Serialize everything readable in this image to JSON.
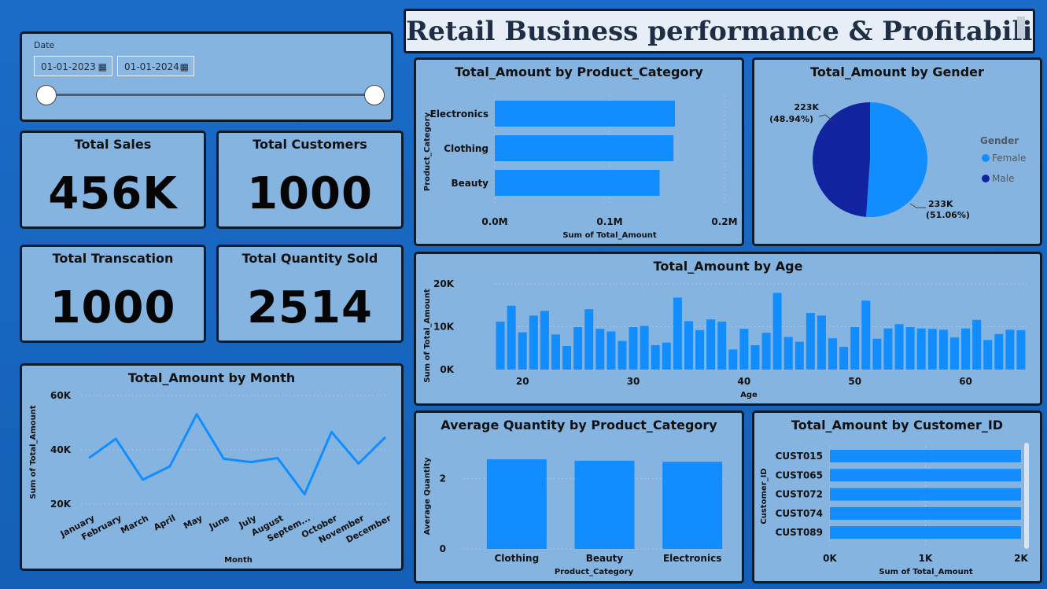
{
  "title": "Retail Business performance & Profitability",
  "date_slicer": {
    "label": "Date",
    "start": "01-01-2023",
    "end": "01-01-2024",
    "calendar_icon": "calendar-icon"
  },
  "kpis": [
    {
      "label": "Total Sales",
      "value": "456K"
    },
    {
      "label": "Total Customers",
      "value": "1000"
    },
    {
      "label": "Total Transcation",
      "value": "1000"
    },
    {
      "label": "Total Quantity Sold",
      "value": "2514"
    }
  ],
  "colors": {
    "bar": "#118dff",
    "male": "#12239e",
    "female": "#118dff",
    "card_bg": "#85b4e0",
    "border": "#0d1b2a"
  },
  "chart_data": [
    {
      "id": "category",
      "type": "bar",
      "orientation": "horizontal",
      "title": "Total_Amount by Product_Category",
      "xlabel": "Sum of Total_Amount",
      "ylabel": "Product_Category",
      "categories": [
        "Electronics",
        "Clothing",
        "Beauty"
      ],
      "values": [
        156905,
        155580,
        143515
      ],
      "xlim": [
        0,
        200000
      ],
      "xticks": [
        {
          "v": 0,
          "label": "0.0M"
        },
        {
          "v": 100000,
          "label": "0.1M"
        },
        {
          "v": 200000,
          "label": "0.2M"
        }
      ]
    },
    {
      "id": "gender",
      "type": "pie",
      "title": "Total_Amount by Gender",
      "legend_title": "Gender",
      "categories": [
        "Female",
        "Male"
      ],
      "values": [
        233,
        223
      ],
      "labels": [
        {
          "value": "233K",
          "pct": "(51.06%)"
        },
        {
          "value": "223K",
          "pct": "(48.94%)"
        }
      ]
    },
    {
      "id": "age",
      "type": "bar",
      "title": "Total_Amount by Age",
      "xlabel": "Age",
      "ylabel": "Sum of Total_Amount",
      "x": [
        18,
        19,
        20,
        21,
        22,
        23,
        24,
        25,
        26,
        27,
        28,
        29,
        30,
        31,
        32,
        33,
        34,
        35,
        36,
        37,
        38,
        39,
        40,
        41,
        42,
        43,
        44,
        45,
        46,
        47,
        48,
        49,
        50,
        51,
        52,
        53,
        54,
        55,
        56,
        57,
        58,
        59,
        60,
        61,
        62,
        63,
        64
      ],
      "values": [
        11200,
        14900,
        8700,
        12600,
        13700,
        8200,
        5500,
        9900,
        14100,
        9500,
        8900,
        6700,
        9900,
        10200,
        5700,
        6300,
        16800,
        11300,
        9200,
        11700,
        11200,
        4700,
        9500,
        5700,
        8600,
        17900,
        7600,
        6500,
        13200,
        12600,
        7300,
        5300,
        9900,
        16100,
        7200,
        9600,
        10600,
        9900,
        9600,
        9500,
        9300,
        7500,
        9600,
        11600,
        6900,
        8300,
        9300
      ],
      "extra_last": 9200,
      "ylim": [
        0,
        20000
      ],
      "yticks": [
        {
          "v": 0,
          "label": "0K"
        },
        {
          "v": 10000,
          "label": "10K"
        },
        {
          "v": 20000,
          "label": "20K"
        }
      ],
      "xticks": [
        20,
        30,
        40,
        50,
        60
      ]
    },
    {
      "id": "month",
      "type": "line",
      "title": "Total_Amount by Month",
      "xlabel": "Month",
      "ylabel": "Sum of Total_Amount",
      "categories": [
        "January",
        "February",
        "March",
        "April",
        "May",
        "June",
        "July",
        "August",
        "Septem...",
        "October",
        "November",
        "December"
      ],
      "values": [
        36980,
        44060,
        28990,
        33870,
        53150,
        36715,
        35465,
        36960,
        23620,
        46580,
        34920,
        44690
      ],
      "ylim": [
        20000,
        60000
      ],
      "yticks": [
        {
          "v": 20000,
          "label": "20K"
        },
        {
          "v": 40000,
          "label": "40K"
        },
        {
          "v": 60000,
          "label": "60K"
        }
      ]
    },
    {
      "id": "avgqty",
      "type": "bar",
      "title": "Average Quantity by Product_Category",
      "xlabel": "Product_Category",
      "ylabel": "Average Quantity",
      "categories": [
        "Clothing",
        "Beauty",
        "Electronics"
      ],
      "values": [
        2.55,
        2.51,
        2.48
      ],
      "ylim": [
        0,
        3
      ],
      "yticks": [
        {
          "v": 0,
          "label": "0"
        },
        {
          "v": 2,
          "label": "2"
        }
      ]
    },
    {
      "id": "customer",
      "type": "bar",
      "orientation": "horizontal",
      "title": "Total_Amount by Customer_ID",
      "xlabel": "Sum of Total_Amount",
      "ylabel": "Customer_ID",
      "categories": [
        "CUST015",
        "CUST065",
        "CUST072",
        "CUST074",
        "CUST089"
      ],
      "values": [
        2000,
        2000,
        2000,
        2000,
        2000
      ],
      "xlim": [
        0,
        2000
      ],
      "xticks": [
        {
          "v": 0,
          "label": "0K"
        },
        {
          "v": 1000,
          "label": "1K"
        },
        {
          "v": 2000,
          "label": "2K"
        }
      ]
    }
  ]
}
